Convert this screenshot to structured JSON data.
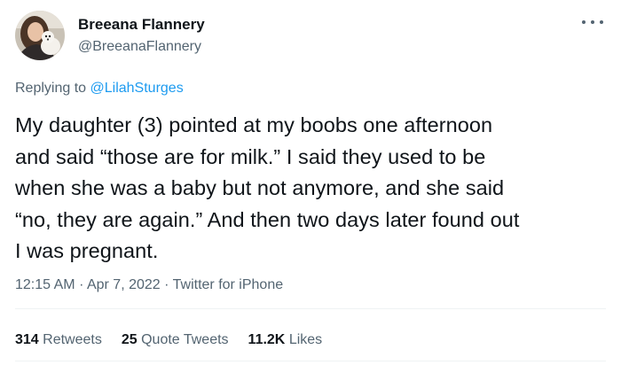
{
  "author": {
    "display_name": "Breeana Flannery",
    "handle": "@BreeanaFlannery"
  },
  "reply": {
    "prefix": "Replying to",
    "mention": "@LilahSturges"
  },
  "tweet": {
    "text": "My daughter (3) pointed at my boobs one afternoon\nand said “those are for milk.” I said they used to be\nwhen she was a baby but not anymore, and she said\n“no, they are again.” And then two days later found out\nI was pregnant."
  },
  "meta": {
    "time": "12:15 AM",
    "separator": "·",
    "date": "Apr 7, 2022",
    "source": "Twitter for iPhone"
  },
  "stats": {
    "retweets_count": "314",
    "retweets_label": "Retweets",
    "quotes_count": "25",
    "quotes_label": "Quote Tweets",
    "likes_count": "11.2K",
    "likes_label": "Likes"
  },
  "icons": {
    "more": "more-horizontal-icon"
  },
  "colors": {
    "text_primary": "#0f1419",
    "text_secondary": "#536471",
    "link": "#1d9bf0",
    "divider": "#eff3f4"
  }
}
